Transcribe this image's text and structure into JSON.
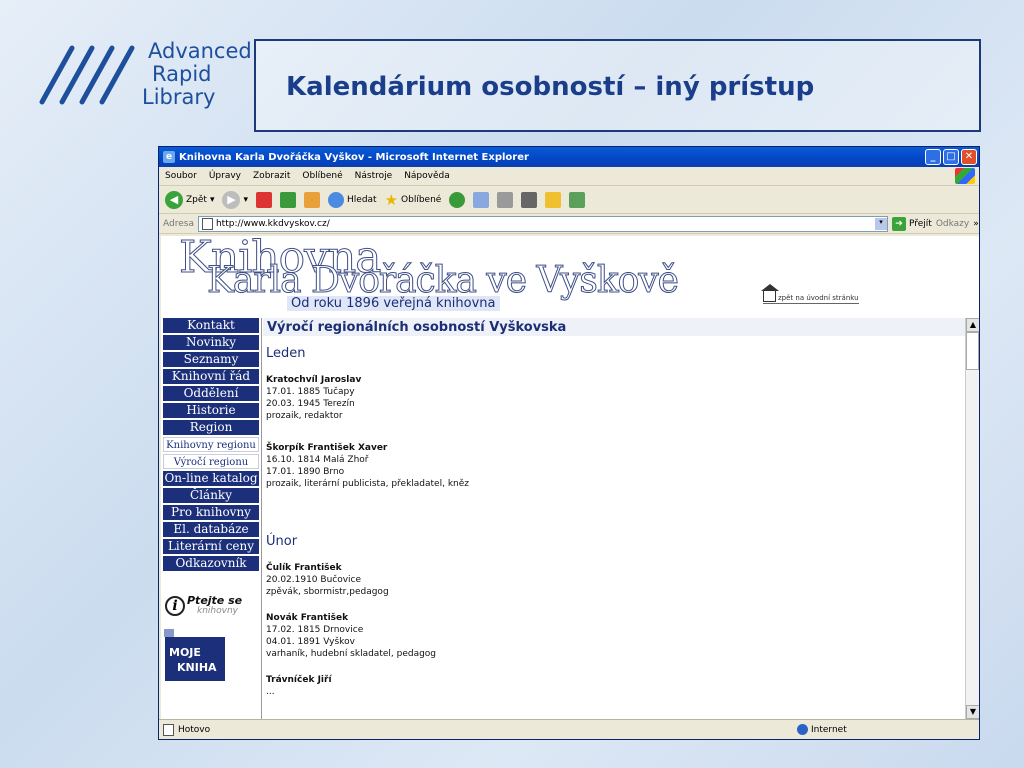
{
  "slide": {
    "logo": {
      "line1": "Advanced",
      "line2": "Rapid",
      "line3": "Library"
    },
    "title": "Kalendárium osobností – iný prístup"
  },
  "browser": {
    "window_title": "Knihovna Karla Dvořáčka Vyškov - Microsoft Internet Explorer",
    "menu": [
      "Soubor",
      "Úpravy",
      "Zobrazit",
      "Oblíbené",
      "Nástroje",
      "Nápověda"
    ],
    "toolbar": {
      "back": "Zpět",
      "search": "Hledat",
      "favorites": "Oblíbené"
    },
    "address_label": "Adresa",
    "address": "http://www.kkdvyskov.cz/",
    "go": "Přejít",
    "links": "Odkazy",
    "status": "Hotovo",
    "zone": "Internet"
  },
  "site": {
    "header_line1": "Knihovna",
    "header_line2": "Karla Dvořáčka ve Vyškově",
    "since": "Od roku 1896 veřejná knihovna",
    "home_link": "zpět na úvodní stránku",
    "nav": [
      "Kontakt",
      "Novinky",
      "Seznamy",
      "Knihovní řád",
      "Oddělení",
      "Historie",
      "Region",
      "Knihovny regionu",
      "Výročí regionu",
      "On-line katalog",
      "Články",
      "Pro knihovny",
      "El. databáze",
      "Literární ceny",
      "Odkazovník"
    ],
    "ptejte": {
      "title": "Ptejte se",
      "sub": "knihovny"
    },
    "moje_kniha": {
      "line1": "MOJE",
      "line2": "KNIHA"
    },
    "page_heading": "Výročí regionálních osobností Vyškovska",
    "months": [
      {
        "name": "Leden",
        "people": [
          {
            "name": "Kratochvíl Jaroslav",
            "lines": [
              "17.01. 1885 Tučapy",
              "20.03. 1945 Terezín",
              "prozaik, redaktor"
            ]
          },
          {
            "name": "Škorpík František Xaver",
            "lines": [
              "16.10. 1814 Malá Zhoř",
              "17.01. 1890 Brno",
              "prozaik, literární publicista, překladatel, kněz"
            ]
          }
        ]
      },
      {
        "name": "Únor",
        "people": [
          {
            "name": "Čulík František",
            "lines": [
              "20.02.1910 Bučovice",
              "zpěvák, sbormistr,pedagog"
            ]
          },
          {
            "name": "Novák František",
            "lines": [
              "17.02. 1815 Drnovice",
              "04.01. 1891 Vyškov",
              "varhaník, hudební skladatel, pedagog"
            ]
          },
          {
            "name": "Trávníček Jiří",
            "lines": [
              "..."
            ]
          }
        ]
      }
    ]
  }
}
